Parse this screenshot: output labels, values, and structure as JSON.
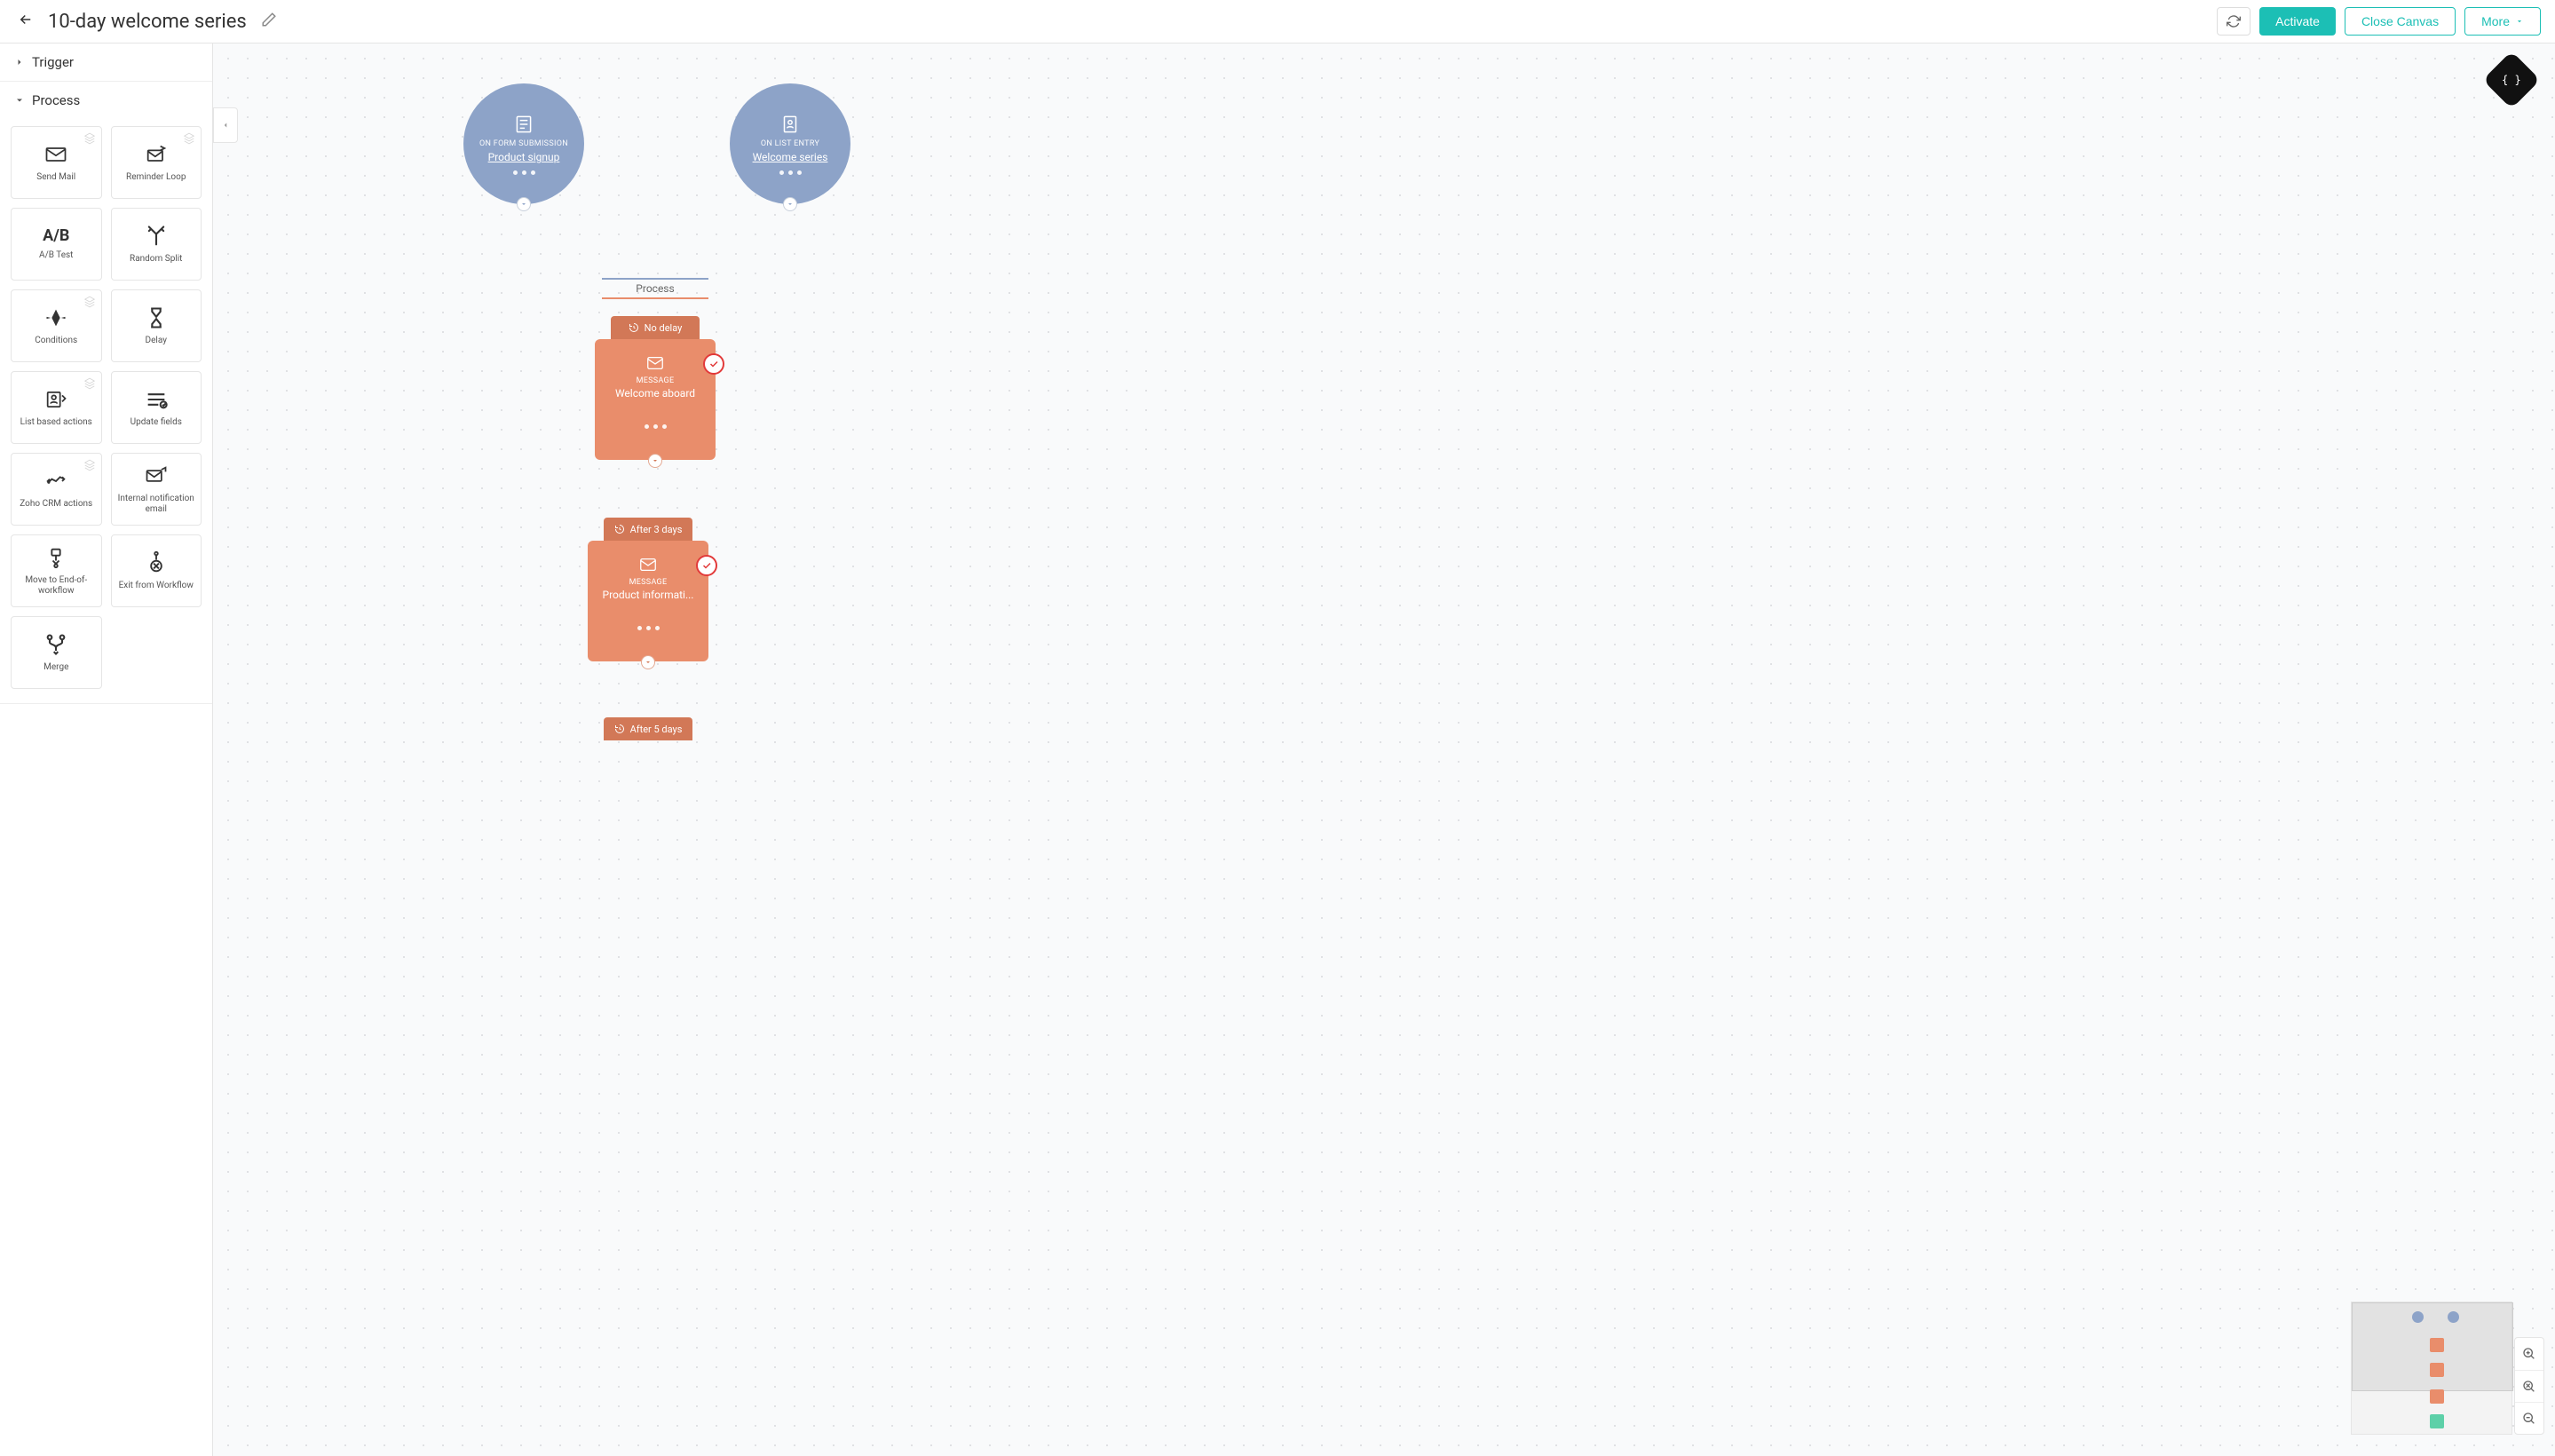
{
  "header": {
    "title": "10-day welcome series",
    "activate": "Activate",
    "close": "Close Canvas",
    "more": "More"
  },
  "sidebar": {
    "trigger_section": "Trigger",
    "process_section": "Process",
    "tools": {
      "send_mail": "Send Mail",
      "reminder_loop": "Reminder Loop",
      "ab_test": "A/B Test",
      "ab_glyph": "A/B",
      "random_split": "Random Split",
      "conditions": "Conditions",
      "delay": "Delay",
      "list_based": "List based actions",
      "update_fields": "Update fields",
      "zoho_crm": "Zoho CRM actions",
      "internal_email": "Internal notification email",
      "move_eow": "Move to End-of-workflow",
      "exit_wf": "Exit from Workflow",
      "merge": "Merge"
    }
  },
  "canvas": {
    "trigger1": {
      "caption": "ON FORM SUBMISSION",
      "link": "Product signup"
    },
    "trigger2": {
      "caption": "ON LIST ENTRY",
      "link": "Welcome series"
    },
    "process_label": "Process",
    "msg1": {
      "delay": "No delay",
      "caption": "MESSAGE",
      "title": "Welcome aboard"
    },
    "msg2": {
      "delay": "After 3 days",
      "caption": "MESSAGE",
      "title": "Product informati..."
    },
    "msg3": {
      "delay": "After 5 days"
    }
  }
}
